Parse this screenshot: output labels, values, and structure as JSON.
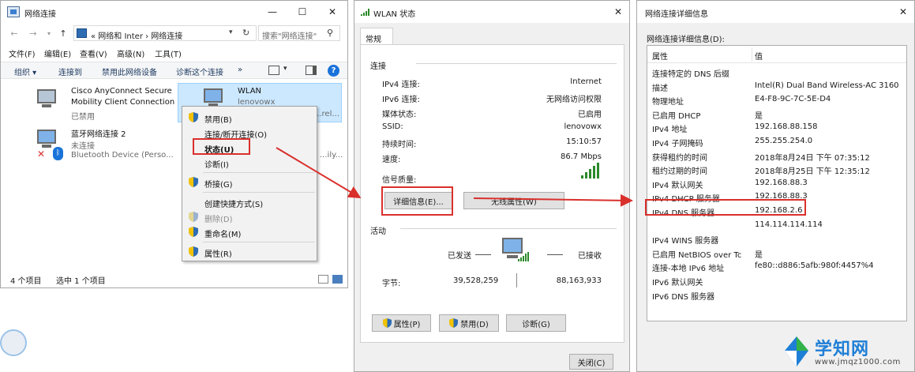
{
  "network_window": {
    "title": "网络连接",
    "crumbs": "« 网络和 Inter  ›  网络连接",
    "search_placeholder": "搜索\"网络连接\"",
    "menus": [
      "文件(F)",
      "编辑(E)",
      "查看(V)",
      "高级(N)",
      "工具(T)"
    ],
    "commands": [
      "组织 ▾",
      "连接到",
      "禁用此网络设备",
      "诊断这个连接",
      "»"
    ],
    "adapters": [
      {
        "name_line1": "Cisco AnyConnect Secure",
        "name_line2": "Mobility Client Connection",
        "status": "已禁用"
      },
      {
        "name_line1": "WLAN",
        "name_line2": "lenovowx",
        "status": "...rel..."
      },
      {
        "name_line1": "蓝牙网络连接 2",
        "name_line2": "未连接",
        "status": "Bluetooth Device (Perso..."
      }
    ],
    "hidden_fragment": "...ily...",
    "status_count": "4 个项目",
    "status_selected": "选中 1 个项目"
  },
  "context_menu": {
    "items": [
      "禁用(B)",
      "连接/断开连接(O)",
      "状态(U)",
      "诊断(I)",
      "桥接(G)",
      "创建快捷方式(S)",
      "删除(D)",
      "重命名(M)",
      "属性(R)"
    ]
  },
  "wlan_window": {
    "title": "WLAN 状态",
    "tab": "常规",
    "section_connection": "连接",
    "rows": [
      {
        "label": "IPv4 连接:",
        "value": "Internet"
      },
      {
        "label": "IPv6 连接:",
        "value": "无网络访问权限"
      },
      {
        "label": "媒体状态:",
        "value": "已启用"
      },
      {
        "label": "SSID:",
        "value": "lenovowx"
      },
      {
        "label": "持续时间:",
        "value": "15:10:57"
      },
      {
        "label": "速度:",
        "value": "86.7 Mbps"
      }
    ],
    "signal_label": "信号质量:",
    "signal_bars": 5,
    "btn_details": "详细信息(E)...",
    "btn_wireless": "无线属性(W)",
    "section_activity": "活动",
    "sent_label": "已发送",
    "received_label": "已接收",
    "bytes_label": "字节:",
    "bytes_sent": "39,528,259",
    "bytes_received": "88,163,933",
    "btn_properties": "属性(P)",
    "btn_disable": "禁用(D)",
    "btn_diagnose": "诊断(G)",
    "btn_close": "关闭(C)"
  },
  "details_window": {
    "title": "网络连接详细信息",
    "list_label": "网络连接详细信息(D):",
    "col_property": "属性",
    "col_value": "值",
    "rows": [
      {
        "k": "连接特定的 DNS 后缀",
        "v": ""
      },
      {
        "k": "描述",
        "v": "Intel(R) Dual Band Wireless-AC 3160"
      },
      {
        "k": "物理地址",
        "v": "E4-F8-9C-7C-5E-D4"
      },
      {
        "k": "已启用 DHCP",
        "v": "是"
      },
      {
        "k": "IPv4 地址",
        "v": "192.168.88.158"
      },
      {
        "k": "IPv4 子网掩码",
        "v": "255.255.254.0"
      },
      {
        "k": "获得租约的时间",
        "v": "2018年8月24日 下午 07:35:12"
      },
      {
        "k": "租约过期的时间",
        "v": "2018年8月25日 下午 12:35:12"
      },
      {
        "k": "IPv4 默认网关",
        "v": "192.168.88.3"
      },
      {
        "k": "IPv4 DHCP 服务器",
        "v": "192.168.88.3"
      },
      {
        "k": "IPv4 DNS 服务器",
        "v": "192.168.2.6"
      },
      {
        "k": "",
        "v": "114.114.114.114"
      },
      {
        "k": "IPv4 WINS 服务器",
        "v": ""
      },
      {
        "k": "已启用 NetBIOS over Tc",
        "v": "是"
      },
      {
        "k": "连接-本地 IPv6 地址",
        "v": "fe80::d886:5afb:980f:4457%4"
      },
      {
        "k": "IPv6 默认网关",
        "v": ""
      },
      {
        "k": "IPv6 DNS 服务器",
        "v": ""
      }
    ]
  },
  "watermark": {
    "text": "学知网",
    "url": "www.jmqz1000.com"
  },
  "colors": {
    "highlight_red": "#d9302c",
    "selection_blue": "#cce8ff",
    "link_blue": "#1e3a62",
    "watermark_blue": "#1f7fd6"
  }
}
